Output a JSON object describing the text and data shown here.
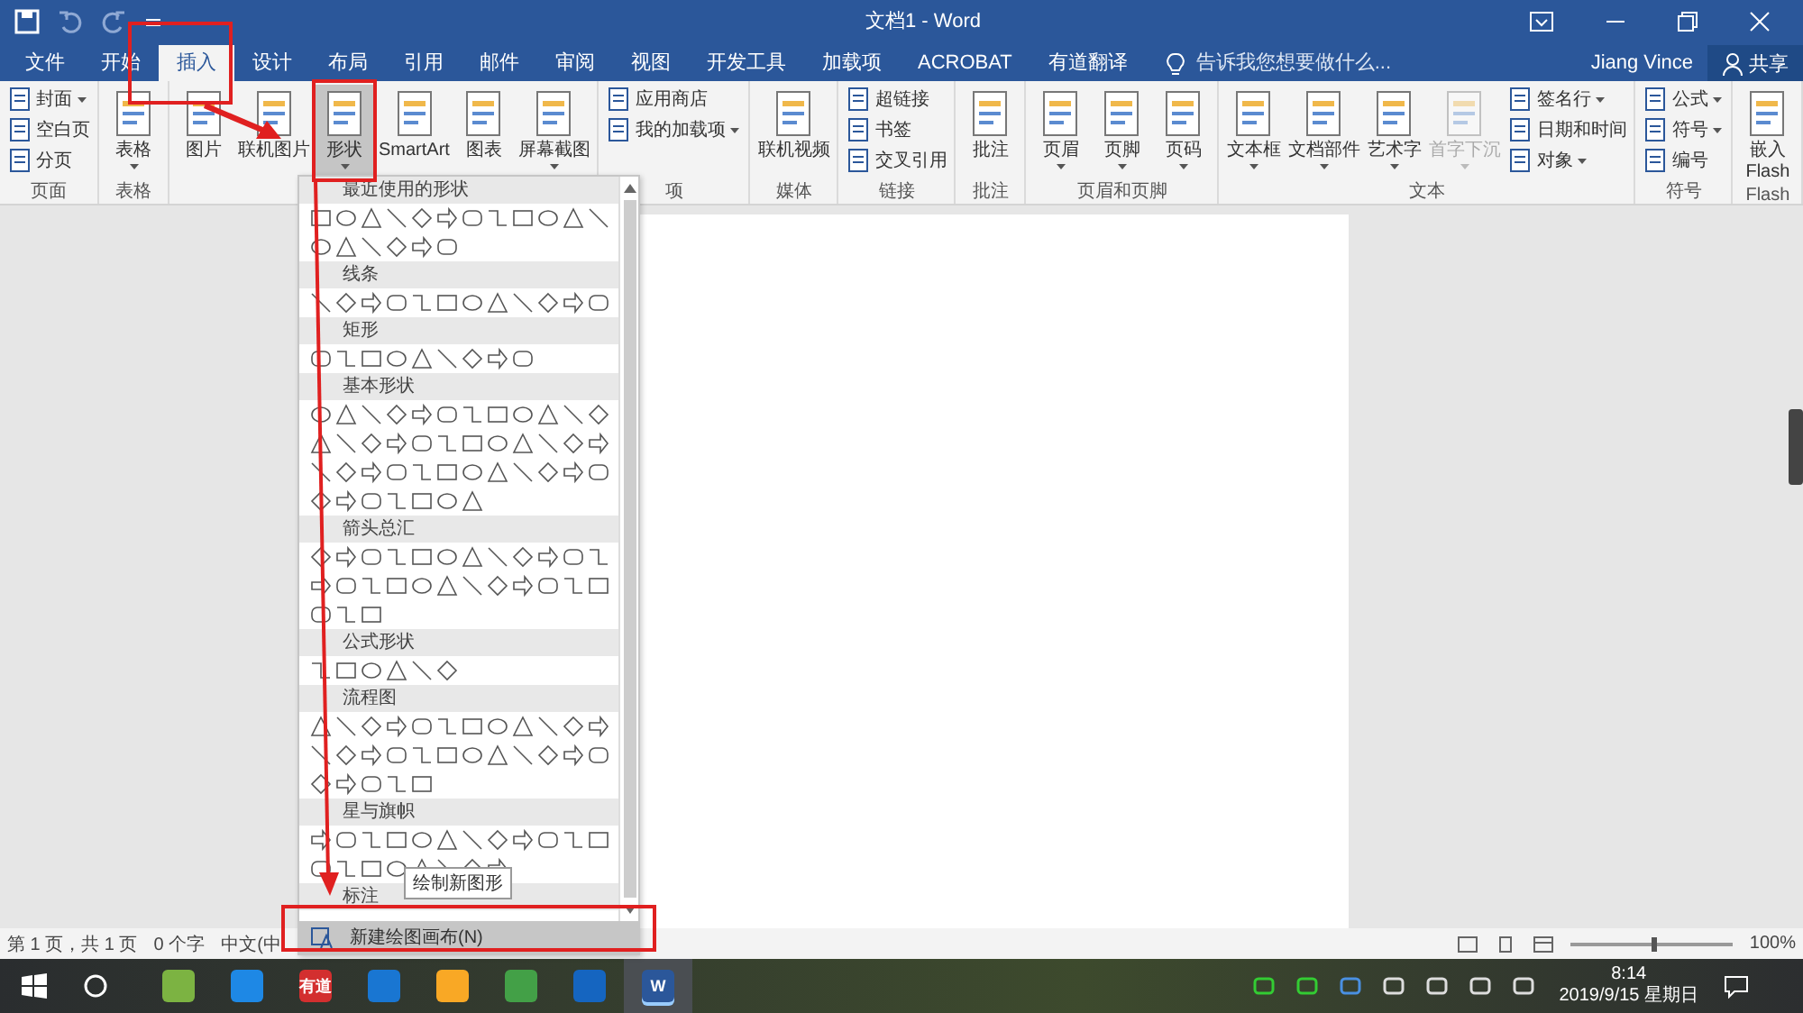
{
  "title_bar": {
    "title": "文档1 - Word"
  },
  "tabs": [
    {
      "label": "文件",
      "selected": false
    },
    {
      "label": "开始",
      "selected": false
    },
    {
      "label": "插入",
      "selected": true
    },
    {
      "label": "设计",
      "selected": false
    },
    {
      "label": "布局",
      "selected": false
    },
    {
      "label": "引用",
      "selected": false
    },
    {
      "label": "邮件",
      "selected": false
    },
    {
      "label": "审阅",
      "selected": false
    },
    {
      "label": "视图",
      "selected": false
    },
    {
      "label": "开发工具",
      "selected": false
    },
    {
      "label": "加载项",
      "selected": false
    },
    {
      "label": "ACROBAT",
      "selected": false
    },
    {
      "label": "有道翻译",
      "selected": false
    }
  ],
  "tell_me": {
    "placeholder": "告诉我您想要做什么..."
  },
  "user": {
    "name": "Jiang Vince",
    "share": "共享"
  },
  "ribbon_groups": [
    {
      "label": "页面",
      "items": [
        {
          "kind": "small",
          "label": "封面",
          "dropdown": true
        },
        {
          "kind": "small",
          "label": "空白页"
        },
        {
          "kind": "small",
          "label": "分页"
        }
      ]
    },
    {
      "label": "表格",
      "items": [
        {
          "kind": "large",
          "label": "表格",
          "dropdown": true
        }
      ]
    },
    {
      "items": [
        {
          "kind": "large",
          "label": "图片"
        },
        {
          "kind": "large",
          "label": "联机图片"
        },
        {
          "kind": "large",
          "label": "形状",
          "dropdown": true,
          "pressed": true
        },
        {
          "kind": "large",
          "label": "SmartArt"
        },
        {
          "kind": "large",
          "label": "图表"
        },
        {
          "kind": "large",
          "label": "屏幕截图",
          "dropdown": true
        }
      ]
    },
    {
      "label": "项",
      "items": [
        {
          "kind": "small",
          "label": "应用商店"
        },
        {
          "kind": "small",
          "label": "我的加载项",
          "dropdown": true
        }
      ]
    },
    {
      "label": "媒体",
      "items": [
        {
          "kind": "large",
          "label": "联机视频"
        }
      ]
    },
    {
      "label": "链接",
      "items": [
        {
          "kind": "small",
          "label": "超链接"
        },
        {
          "kind": "small",
          "label": "书签"
        },
        {
          "kind": "small",
          "label": "交叉引用"
        }
      ]
    },
    {
      "label": "批注",
      "items": [
        {
          "kind": "large",
          "label": "批注"
        }
      ]
    },
    {
      "label": "页眉和页脚",
      "items": [
        {
          "kind": "large",
          "label": "页眉",
          "dropdown": true
        },
        {
          "kind": "large",
          "label": "页脚",
          "dropdown": true
        },
        {
          "kind": "large",
          "label": "页码",
          "dropdown": true
        }
      ]
    },
    {
      "label": "文本",
      "items": [
        {
          "kind": "large",
          "label": "文本框",
          "dropdown": true
        },
        {
          "kind": "large",
          "label": "文档部件",
          "dropdown": true
        },
        {
          "kind": "large",
          "label": "艺术字",
          "dropdown": true
        },
        {
          "kind": "large",
          "label": "首字下沉",
          "dropdown": true,
          "disabled": true
        },
        {
          "kind": "small",
          "label": "签名行",
          "dropdown": true
        },
        {
          "kind": "small",
          "label": "日期和时间"
        },
        {
          "kind": "small",
          "label": "对象",
          "dropdown": true
        }
      ]
    },
    {
      "label": "符号",
      "items": [
        {
          "kind": "small",
          "label": "公式",
          "dropdown": true
        },
        {
          "kind": "small",
          "label": "符号",
          "dropdown": true
        },
        {
          "kind": "small",
          "label": "编号"
        }
      ]
    },
    {
      "label": "Flash",
      "items": [
        {
          "kind": "large",
          "label": "嵌入\nFlash"
        }
      ]
    }
  ],
  "shapes_menu": {
    "sections": [
      {
        "heading": "最近使用的形状"
      },
      {
        "heading": "线条"
      },
      {
        "heading": "矩形"
      },
      {
        "heading": "基本形状"
      },
      {
        "heading": "箭头总汇"
      },
      {
        "heading": "公式形状"
      },
      {
        "heading": "流程图"
      },
      {
        "heading": "星与旗帜"
      },
      {
        "heading": "标注"
      }
    ],
    "footer": {
      "label": "新建绘图画布(N)"
    },
    "tooltip": "绘制新图形"
  },
  "status_bar": {
    "items": [
      "第 1 页，共 1 页",
      "0 个字",
      "中文(中"
    ],
    "zoom_slider": {
      "level": 0.5
    },
    "zoom": "100%"
  },
  "taskbar": {
    "apps": [
      {
        "color": "#7cb342"
      },
      {
        "color": "#1e88e5"
      },
      {
        "color": "#d32f2f",
        "label": "有道"
      },
      {
        "color": "#1976d2"
      },
      {
        "color": "#f9a825"
      },
      {
        "color": "#43a047"
      },
      {
        "color": "#1565c0"
      },
      {
        "color": "#2b579a",
        "label": "W",
        "selected": true
      }
    ],
    "time": "8:14",
    "date": "2019/9/15 星期日"
  }
}
